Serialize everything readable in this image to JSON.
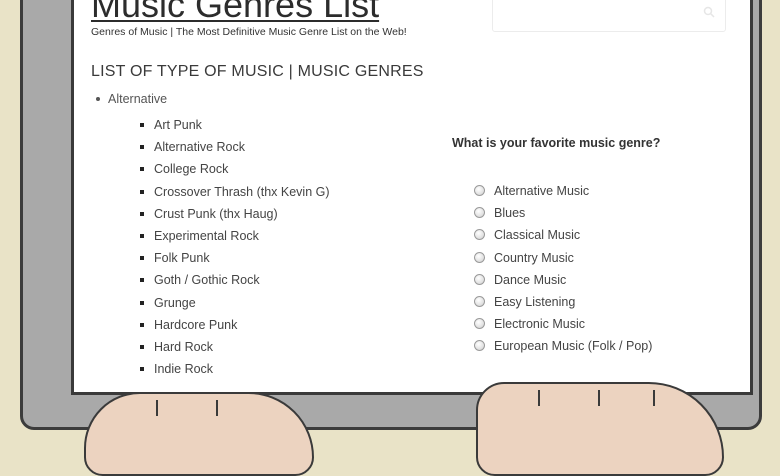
{
  "header": {
    "site_title": "Music Genres List",
    "tagline": "Genres of Music | The Most Definitive Music Genre List on the Web!"
  },
  "main": {
    "section_heading": "LIST OF TYPE OF MUSIC | MUSIC GENRES",
    "parent_genre": "Alternative",
    "subgenres": [
      "Art Punk",
      "Alternative Rock",
      "College Rock",
      "Crossover Thrash (thx Kevin G)",
      "Crust Punk (thx Haug)",
      "Experimental Rock",
      "Folk Punk",
      "Goth / Gothic Rock",
      "Grunge",
      "Hardcore Punk",
      "Hard Rock",
      "Indie Rock"
    ]
  },
  "poll": {
    "question": "What is your favorite music genre?",
    "options": [
      "Alternative Music",
      "Blues",
      "Classical Music",
      "Country Music",
      "Dance Music",
      "Easy Listening",
      "Electronic Music",
      "European Music (Folk / Pop)"
    ]
  },
  "colors": {
    "background": "#e9e3c7",
    "monitor_bezel": "#a9a9a9",
    "screen": "#ffffff",
    "skin": "#ecd3c0"
  },
  "icons": {
    "search": "search-icon",
    "radio": "radio-button-icon"
  }
}
